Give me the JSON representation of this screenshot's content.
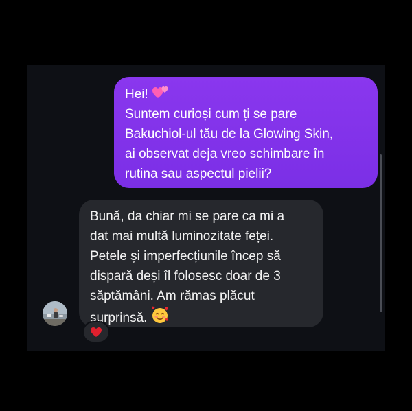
{
  "conversation": {
    "sent_message": {
      "lines": [
        "Hei!",
        "Suntem curioși cum ți se pare",
        "Bakuchiol-ul tău de la Glowing Skin,",
        "ai observat deja vreo schimbare în",
        "rutina sau aspectul pielii?"
      ],
      "emoji": "two-hearts-icon",
      "color": "#8a37ee"
    },
    "received_message": {
      "lines": [
        "Bună, da chiar mi se pare ca mi a",
        "dat mai multă luminozitate feței.",
        "Petele și imperfecțiunile încep să",
        "dispară deși îl folosesc doar de 3",
        "săptămâni. Am rămas plăcut",
        "surprinsă."
      ],
      "emoji": "smiling-face-with-hearts-icon",
      "color": "#26282d"
    },
    "reaction": {
      "icon": "red-heart-icon",
      "color": "#e0202e"
    },
    "avatar": {
      "icon": "profile-photo-avatar"
    }
  }
}
